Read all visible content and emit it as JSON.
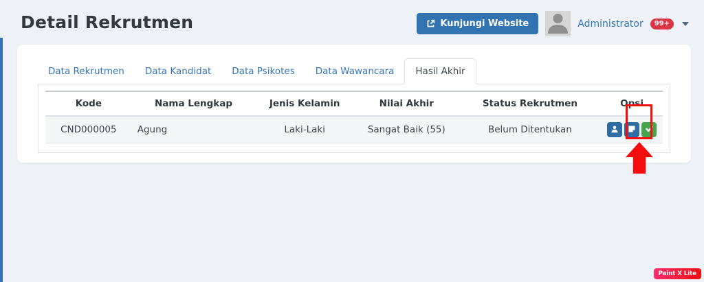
{
  "page": {
    "title": "Detail Rekrutmen"
  },
  "header": {
    "visit_button": {
      "label": "Kunjungi Website",
      "icon": "external-link-icon"
    },
    "user": {
      "name": "Administrator",
      "badge": "99+",
      "avatar_icon": "person-silhouette-icon"
    }
  },
  "tabs": [
    {
      "label": "Data Rekrutmen",
      "active": false
    },
    {
      "label": "Data Kandidat",
      "active": false
    },
    {
      "label": "Data Psikotes",
      "active": false
    },
    {
      "label": "Data Wawancara",
      "active": false
    },
    {
      "label": "Hasil Akhir",
      "active": true
    }
  ],
  "table": {
    "columns": [
      "Kode",
      "Nama Lengkap",
      "Jenis Kelamin",
      "Nilai Akhir",
      "Status Rekrutmen",
      "Opsi"
    ],
    "rows": [
      {
        "kode": "CND000005",
        "nama": "Agung",
        "jenis_kelamin": "Laki-Laki",
        "nilai_akhir": "Sangat Baik (55)",
        "status": "Belum Ditentukan",
        "opsi_icons": [
          "user-icon",
          "note-icon",
          "check-icon"
        ]
      }
    ]
  },
  "annotations": {
    "highlight": "red rectangle around approve button",
    "arrow": "red arrow pointing up at approve button",
    "color": "#f50d0d"
  },
  "watermark": {
    "label": "Paint X Lite"
  },
  "colors": {
    "background": "#eef1f6",
    "link_blue": "#3474b8",
    "primary_button_blue": "#3273b1",
    "action_button_blue": "#2e6da4",
    "action_button_green": "#47a44e",
    "badge_red": "#dc3545",
    "annotation_red": "#f50d0d",
    "sidebar_blue": "#3173b3"
  }
}
